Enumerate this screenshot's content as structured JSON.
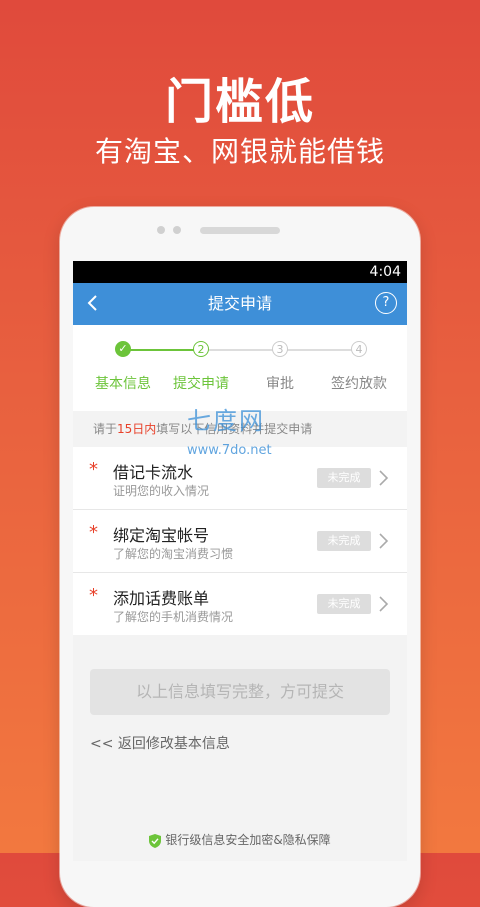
{
  "promo": {
    "headline": "门槛低",
    "subline": "有淘宝、网银就能借钱"
  },
  "status_bar": {
    "time": "4:04"
  },
  "nav": {
    "back_icon": "chevron-left-icon",
    "title": "提交申请",
    "help_label": "?"
  },
  "steps": [
    {
      "number": "✓",
      "label": "基本信息",
      "state": "done"
    },
    {
      "number": "2",
      "label": "提交申请",
      "state": "current"
    },
    {
      "number": "3",
      "label": "审批",
      "state": "pending"
    },
    {
      "number": "4",
      "label": "签约放款",
      "state": "pending"
    }
  ],
  "notice": {
    "prefix": "请于",
    "highlight": "15日内",
    "suffix": "填写以下信用资料并提交申请"
  },
  "watermark": {
    "title": "七度网",
    "url": "www.7do.net"
  },
  "items": [
    {
      "required_mark": "*",
      "title": "借记卡流水",
      "desc": "证明您的收入情况",
      "status": "未完成"
    },
    {
      "required_mark": "*",
      "title": "绑定淘宝帐号",
      "desc": "了解您的淘宝消费习惯",
      "status": "未完成"
    },
    {
      "required_mark": "*",
      "title": "添加话费账单",
      "desc": "了解您的手机消费情况",
      "status": "未完成"
    }
  ],
  "submit_label": "以上信息填写完整，方可提交",
  "back_link": "<< 返回修改基本信息",
  "security_text": "银行级信息安全加密&隐私保障",
  "colors": {
    "accent_blue": "#3e8fd8",
    "step_green": "#6cc43a",
    "required_red": "#e8412a",
    "background_top": "#e04a3c",
    "background_bottom": "#f2783f"
  }
}
